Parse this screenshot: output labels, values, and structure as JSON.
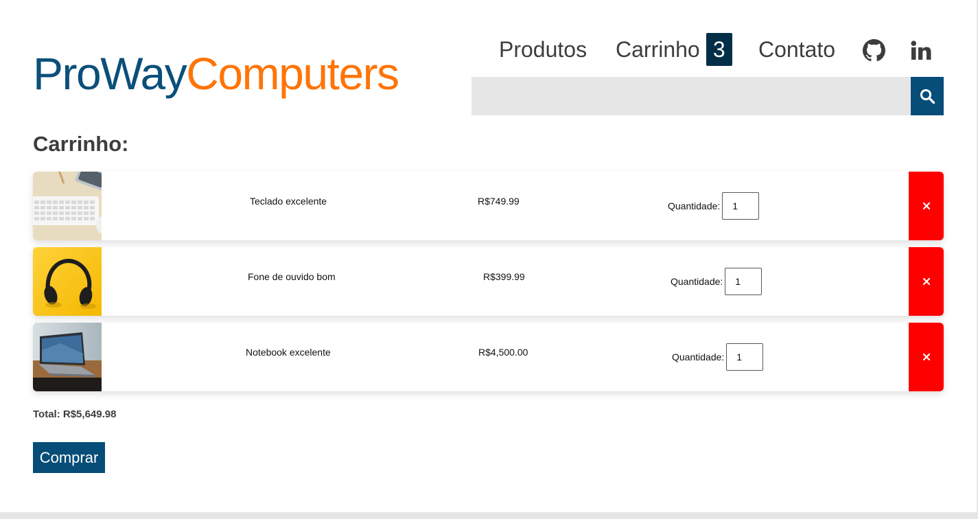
{
  "brand": {
    "part1": "ProWay",
    "part2": "Computers",
    "color1": "#0b4f7a",
    "color2": "#ff7407"
  },
  "nav": {
    "produtos": "Produtos",
    "carrinho": "Carrinho",
    "cart_count": "3",
    "contato": "Contato",
    "icons": [
      "github-icon",
      "linkedin-icon"
    ]
  },
  "search": {
    "placeholder": "",
    "icon": "search-icon"
  },
  "cart": {
    "title": "Carrinho:",
    "qty_label": "Quantidade:",
    "items": [
      {
        "name": "Teclado excelente",
        "price": "R$749.99",
        "quantity": "1",
        "image": "keyboard-photo"
      },
      {
        "name": "Fone de ouvido bom",
        "price": "R$399.99",
        "quantity": "1",
        "image": "headphones-photo"
      },
      {
        "name": "Notebook excelente",
        "price": "R$4,500.00",
        "quantity": "1",
        "image": "laptop-photo"
      }
    ],
    "total": "Total: R$5,649.98",
    "buy_label": "Comprar"
  },
  "colors": {
    "accent": "#064d78",
    "badge": "#032e47",
    "remove": "#ff0000",
    "search_bg": "#e6e6e6"
  }
}
